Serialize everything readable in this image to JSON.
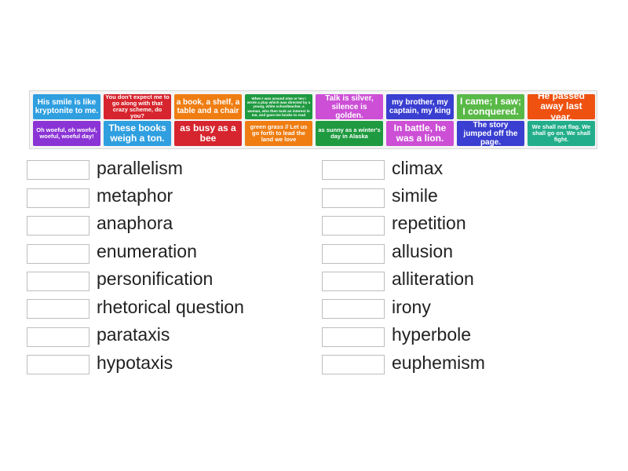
{
  "colors": {
    "blue": "#2f9fe0",
    "red": "#d6252e",
    "orange": "#ef7d12",
    "green": "#1f9a40",
    "magenta": "#cc4fd6",
    "indigo": "#3a3fd1",
    "lime": "#59b947",
    "redorange": "#ee5110",
    "purple": "#8b34d6",
    "teal": "#22ae8a"
  },
  "tiles": [
    {
      "name": "tile-his-smile",
      "text": "His smile is like kryptonite to me.",
      "color": "blue"
    },
    {
      "name": "tile-you-dont-expect",
      "text": "You don't expect me to go along with that crazy scheme, do you?",
      "color": "red"
    },
    {
      "name": "tile-book-shelf",
      "text": "a book, a shelf, a table and a chair",
      "color": "orange"
    },
    {
      "name": "tile-when-i-was-around",
      "text": "When I was around nine or ten I wrote a play which was directed by a young, white schoolteacher, a woman, who then took an interest in me, and gave me books to read",
      "color": "green"
    },
    {
      "name": "tile-talk-is-silver",
      "text": "Talk is silver, silence is golden.",
      "color": "magenta"
    },
    {
      "name": "tile-my-brother",
      "text": "my brother, my captain, my king",
      "color": "indigo"
    },
    {
      "name": "tile-i-came",
      "text": "I came; I saw; I conquered.",
      "color": "lime"
    },
    {
      "name": "tile-he-passed",
      "text": "He passed away last year.",
      "color": "redorange"
    },
    {
      "name": "tile-oh-woeful",
      "text": "Oh woeful, oh woeful, woeful, woeful day!",
      "color": "purple"
    },
    {
      "name": "tile-these-books",
      "text": "These books weigh a ton.",
      "color": "blue"
    },
    {
      "name": "tile-as-busy",
      "text": "as busy as a bee",
      "color": "red"
    },
    {
      "name": "tile-green-grass",
      "text": "green grass // Let us go forth to lead the land we love",
      "color": "orange"
    },
    {
      "name": "tile-as-sunny",
      "text": "as sunny as a winter's day in Alaska",
      "color": "green"
    },
    {
      "name": "tile-in-battle",
      "text": "In battle, he was a lion.",
      "color": "magenta"
    },
    {
      "name": "tile-story-jumped",
      "text": "The story jumped off the page.",
      "color": "indigo"
    },
    {
      "name": "tile-we-shall-not-flag",
      "text": "We shall not flag. We shall go on. We shall fight.",
      "color": "teal"
    }
  ],
  "terms_left": [
    "parallelism",
    "metaphor",
    "anaphora",
    "enumeration",
    "personification",
    "rhetorical question",
    "parataxis",
    "hypotaxis"
  ],
  "terms_right": [
    "climax",
    "simile",
    "repetition",
    "allusion",
    "alliteration",
    "irony",
    "hyperbole",
    "euphemism"
  ]
}
